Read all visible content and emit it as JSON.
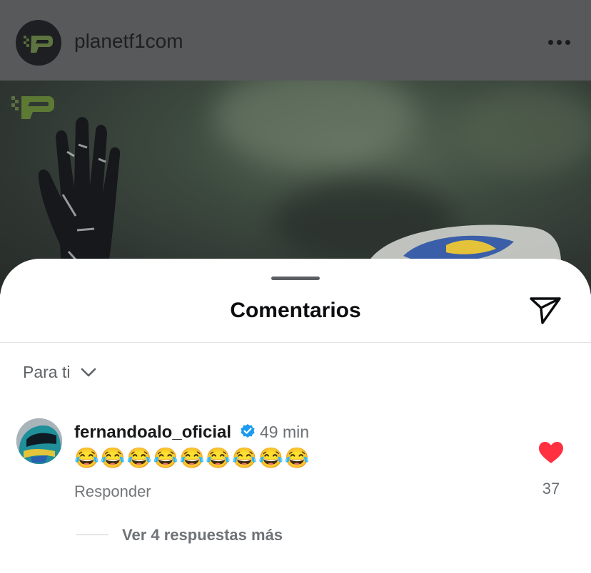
{
  "post": {
    "username": "planetf1com",
    "avatar_icon": "planetf1-logo-icon",
    "more_icon": "more-horizontal-icon"
  },
  "sheet": {
    "title": "Comentarios",
    "share_icon": "send-paper-plane-icon",
    "sort": {
      "label": "Para ti",
      "icon": "chevron-down-icon"
    }
  },
  "comment": {
    "username": "fernandoalo_oficial",
    "verified_icon": "verified-badge-icon",
    "time": "49 min",
    "text": "😂😂😂😂😂😂😂😂😂",
    "reply_label": "Responder",
    "likes": "37",
    "liked": true,
    "like_color": "#ff3040",
    "view_replies": "Ver 4 respuestas más"
  }
}
